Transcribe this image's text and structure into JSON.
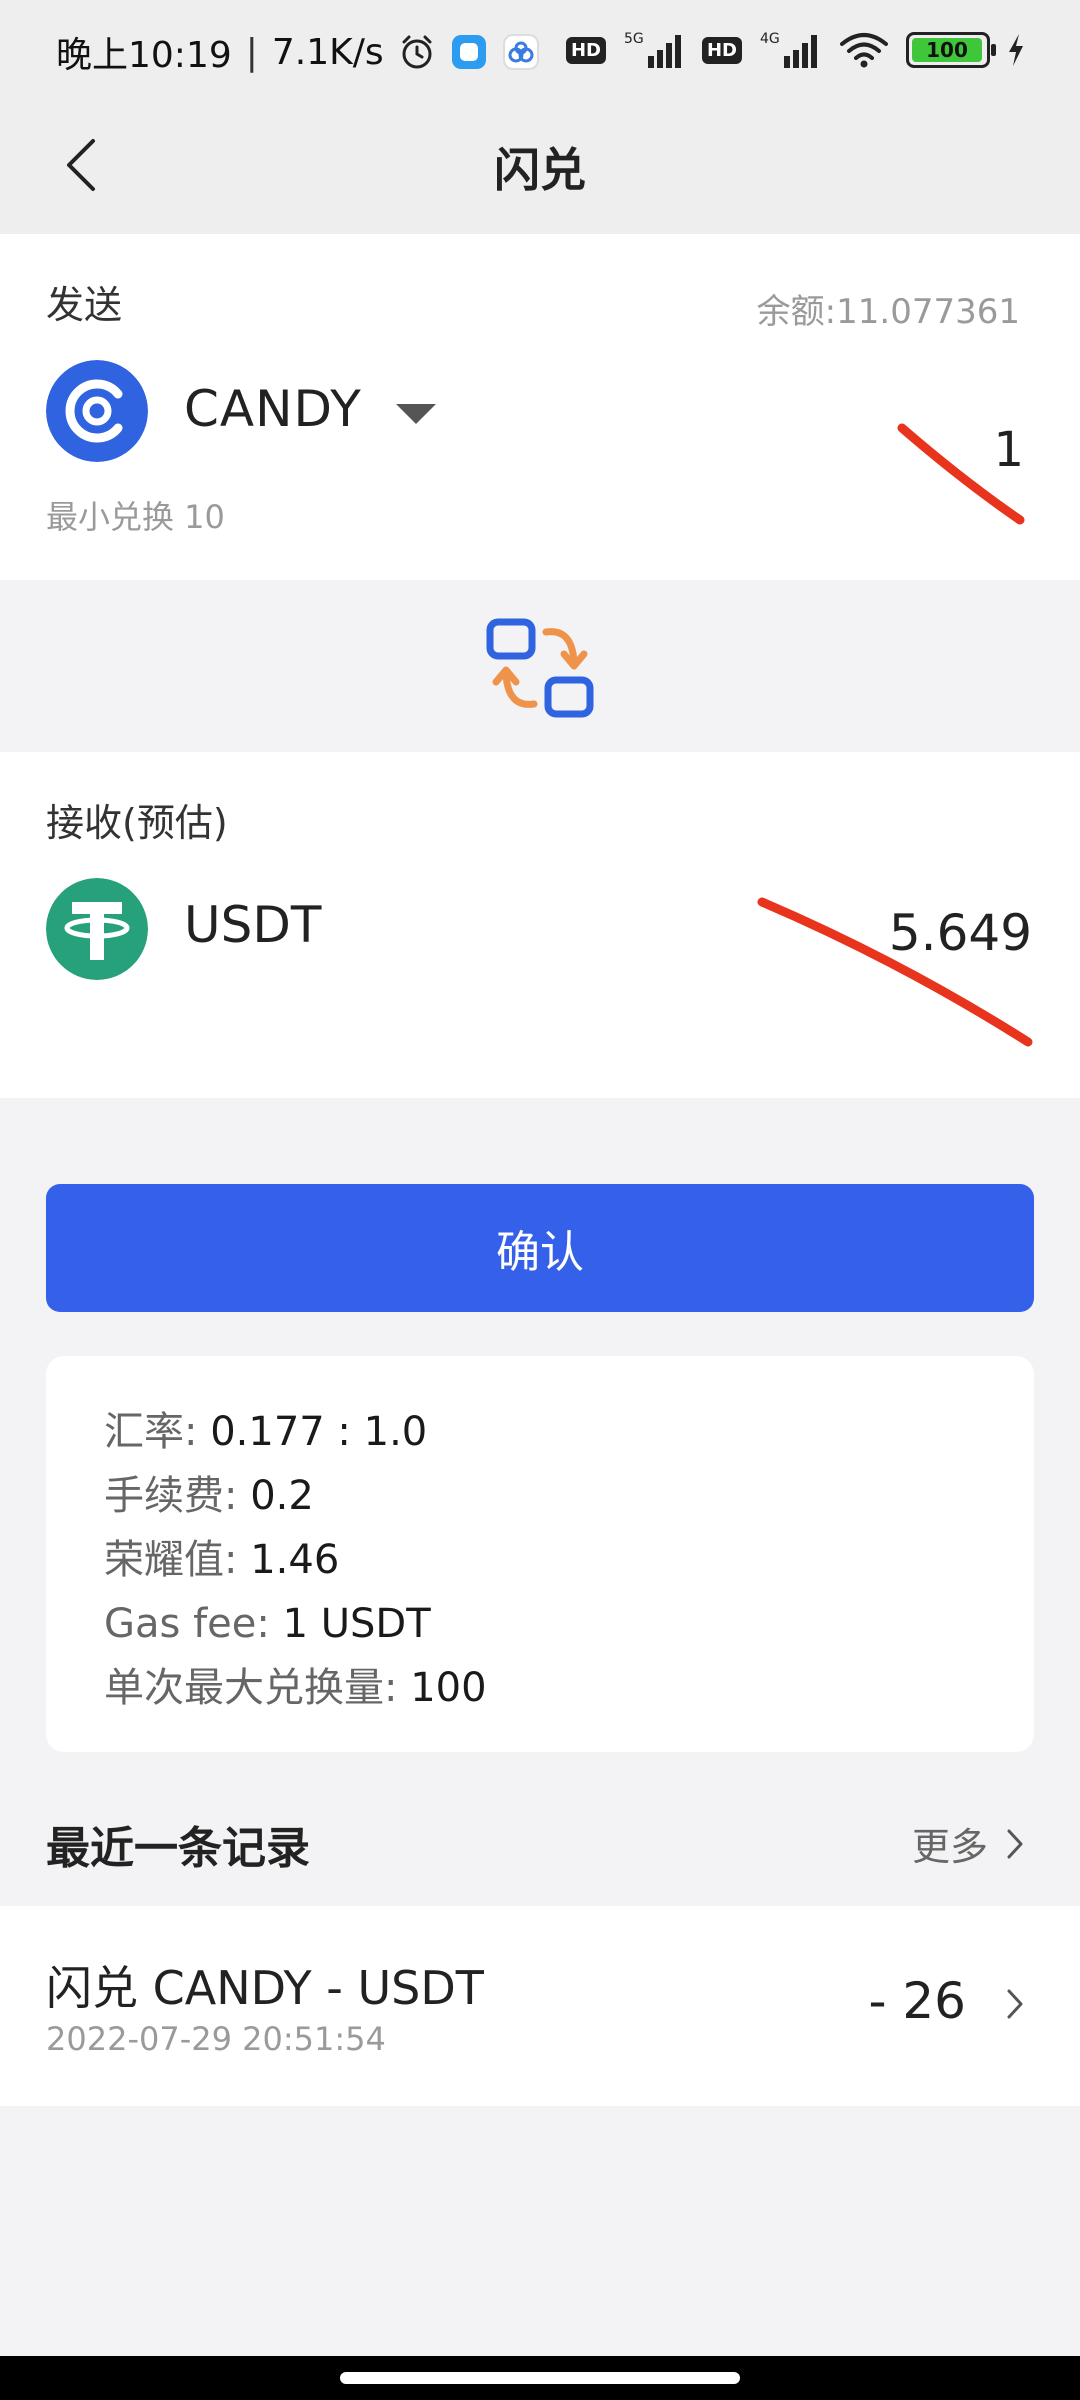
{
  "status_bar": {
    "time": "晚上10:19",
    "separator": "|",
    "net_speed": "7.1K/s",
    "signal_5g": "5G",
    "signal_4g": "4G",
    "hd": "HD",
    "battery": "100",
    "icons": [
      "alarm-icon",
      "app-icon",
      "cloud-icon",
      "signal-icon",
      "wifi-icon",
      "battery-icon",
      "charging-icon"
    ]
  },
  "header": {
    "title": "闪兑",
    "back_icon": "chevron-left-icon"
  },
  "send": {
    "label": "发送",
    "balance": "余额:11.077361",
    "coin": "CANDY",
    "amount": "1",
    "min_swap": "最小兑换 10"
  },
  "receive": {
    "label": "接收(预估)",
    "coin": "USDT",
    "amount": "5.649"
  },
  "confirm": {
    "label": "确认"
  },
  "info": {
    "rows": [
      {
        "label": "汇率: ",
        "value": "0.177 : 1.0"
      },
      {
        "label": "手续费: ",
        "value": "0.2"
      },
      {
        "label": "荣耀值: ",
        "value": "1.46"
      },
      {
        "label": "Gas fee: ",
        "value": "1 USDT"
      },
      {
        "label": "单次最大兑换量: ",
        "value": "100"
      }
    ]
  },
  "recent": {
    "title": "最近一条记录",
    "more": "更多",
    "record": {
      "title": "闪兑 CANDY - USDT",
      "time": "2022-07-29 20:51:54",
      "amount": "- 26"
    }
  },
  "colors": {
    "accent": "#3560ea",
    "usdt": "#26a17b",
    "swap_orange": "#f0934a",
    "annotation": "#e8341c"
  }
}
